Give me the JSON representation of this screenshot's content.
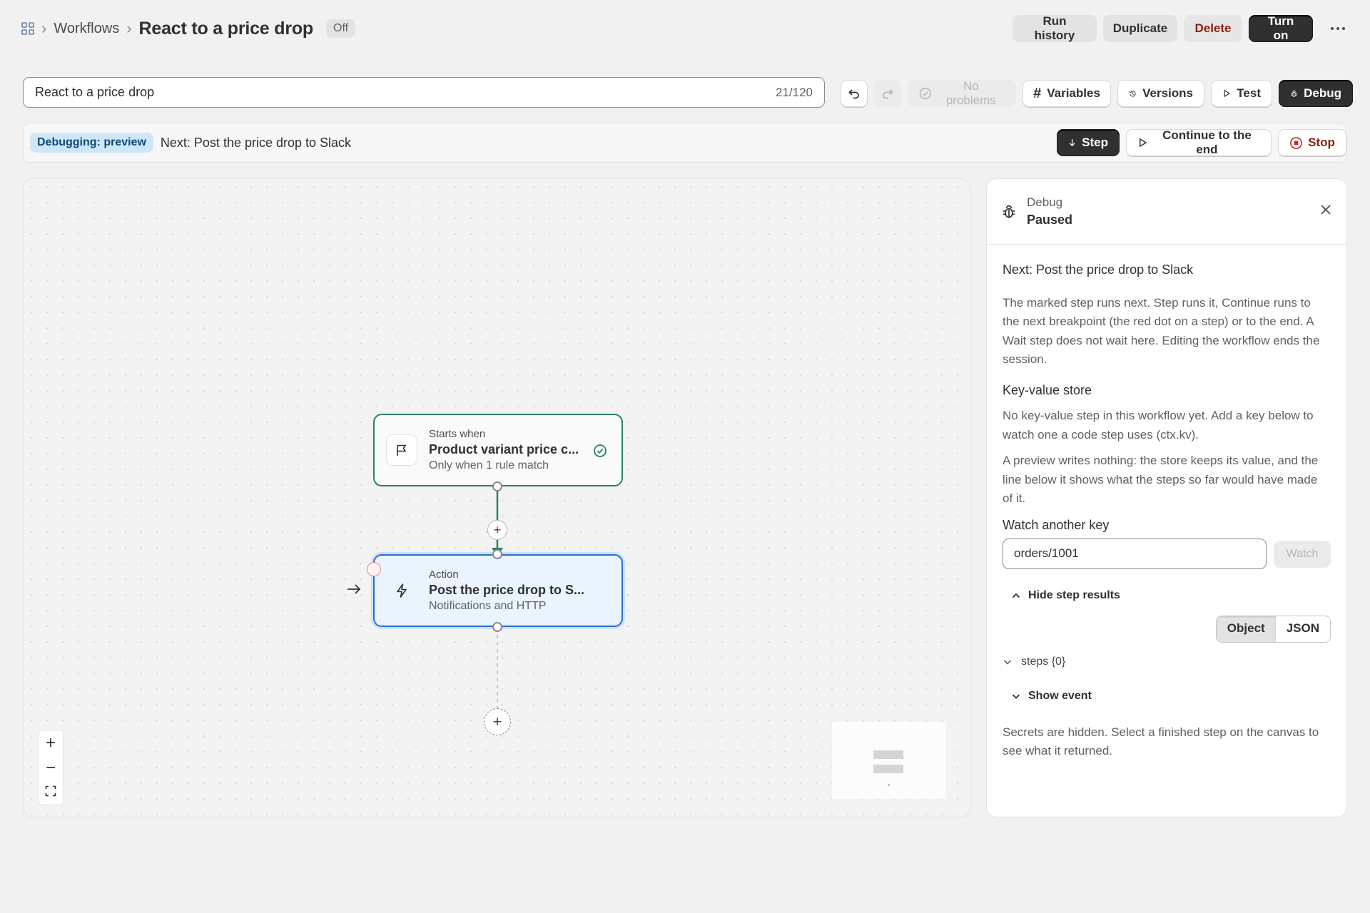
{
  "header": {
    "breadcrumb_link": "Workflows",
    "title": "React to a price drop",
    "status_badge": "Off",
    "actions": {
      "run_history": "Run history",
      "duplicate": "Duplicate",
      "delete": "Delete",
      "turn_on": "Turn on"
    }
  },
  "toolbar": {
    "name_value": "React to a price drop",
    "name_count": "21/120",
    "no_problems": "No problems",
    "variables": "Variables",
    "versions": "Versions",
    "test": "Test",
    "debug": "Debug"
  },
  "debug_bar": {
    "badge": "Debugging: preview",
    "next_text": "Next: Post the price drop to Slack",
    "step": "Step",
    "continue": "Continue to the end",
    "stop": "Stop"
  },
  "canvas": {
    "trigger": {
      "kicker": "Starts when",
      "title": "Product variant price c...",
      "subtitle": "Only when 1 rule match"
    },
    "action": {
      "kicker": "Action",
      "title": "Post the price drop to S...",
      "subtitle": "Notifications and HTTP"
    }
  },
  "panel": {
    "label": "Debug",
    "status": "Paused",
    "next": "Next: Post the price drop to Slack",
    "explain": "The marked step runs next. Step runs it, Continue runs to the next breakpoint (the red dot on a step) or to the end. A Wait step does not wait here. Editing the workflow ends the session.",
    "kv_heading": "Key-value store",
    "kv_empty": "No key-value step in this workflow yet. Add a key below to watch one a code step uses (ctx.kv).",
    "kv_preview": "A preview writes nothing: the store keeps its value, and the line below it shows what the steps so far would have made of it.",
    "watch_label": "Watch another key",
    "watch_value": "orders/1001",
    "watch_button": "Watch",
    "hide_results": "Hide step results",
    "seg_object": "Object",
    "seg_json": "JSON",
    "steps_tree": "steps {0}",
    "show_event": "Show event",
    "footer": "Secrets are hidden. Select a finished step on the canvas to see what it returned."
  },
  "colors": {
    "accent_green": "#29845a",
    "accent_blue": "#2c6ecb",
    "danger": "#8e1f0b",
    "dark_button": "#303030"
  }
}
